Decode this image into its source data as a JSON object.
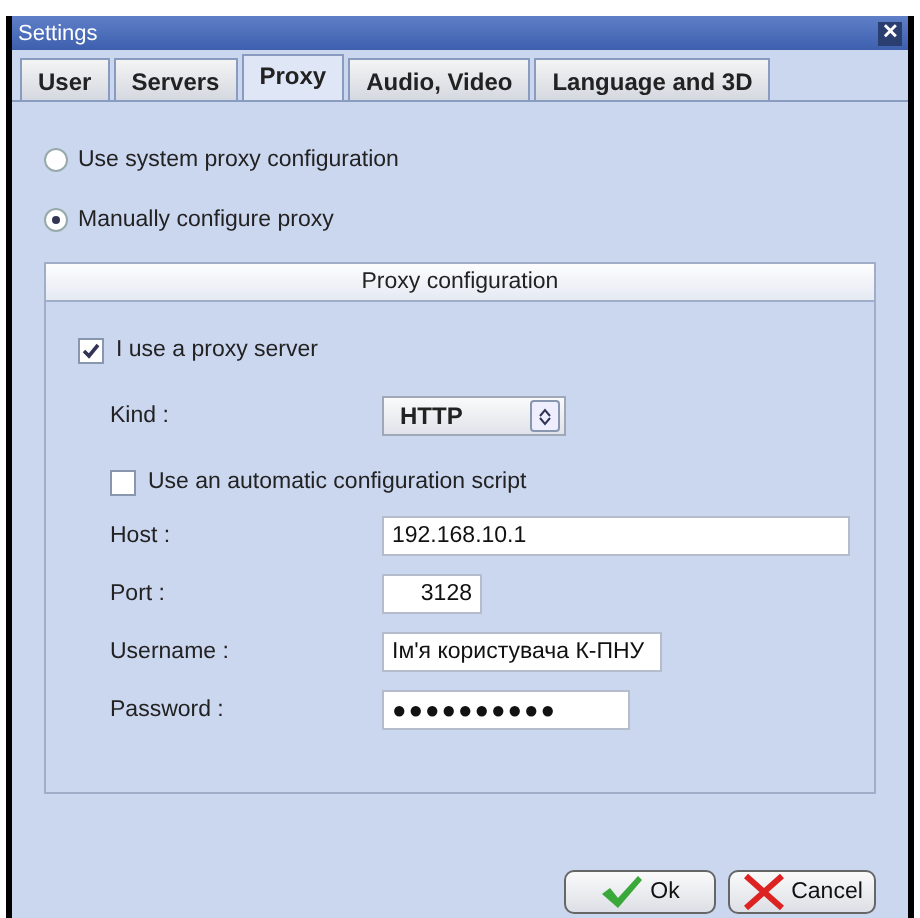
{
  "window": {
    "title": "Settings",
    "close": "✕"
  },
  "tabs": [
    {
      "label": "User",
      "selected": false
    },
    {
      "label": "Servers",
      "selected": false
    },
    {
      "label": "Proxy",
      "selected": true
    },
    {
      "label": "Audio, Video",
      "selected": false
    },
    {
      "label": "Language and 3D",
      "selected": false
    }
  ],
  "proxy_mode": [
    {
      "label": "Use system proxy configuration",
      "selected": false
    },
    {
      "label": "Manually configure proxy",
      "selected": true
    }
  ],
  "panel": {
    "title": "Proxy configuration",
    "use_proxy": {
      "label": "I use a proxy server",
      "checked": true
    },
    "kind": {
      "label": "Kind :",
      "value": "HTTP"
    },
    "auto_script": {
      "label": "Use an automatic configuration script",
      "checked": false
    },
    "fields": [
      {
        "label": "Host :",
        "value": "192.168.10.1",
        "kind": "wide"
      },
      {
        "label": "Port :",
        "value": "3128",
        "kind": "short"
      },
      {
        "label": "Username :",
        "value": "Ім'я користувача К-ПНУ",
        "kind": "medium"
      },
      {
        "label": "Password :",
        "value": "●●●●●●●●●●",
        "kind": "password"
      }
    ]
  },
  "buttons": [
    {
      "label": "Ok",
      "kind": "ok"
    },
    {
      "label": "Cancel",
      "kind": "cancel"
    }
  ]
}
